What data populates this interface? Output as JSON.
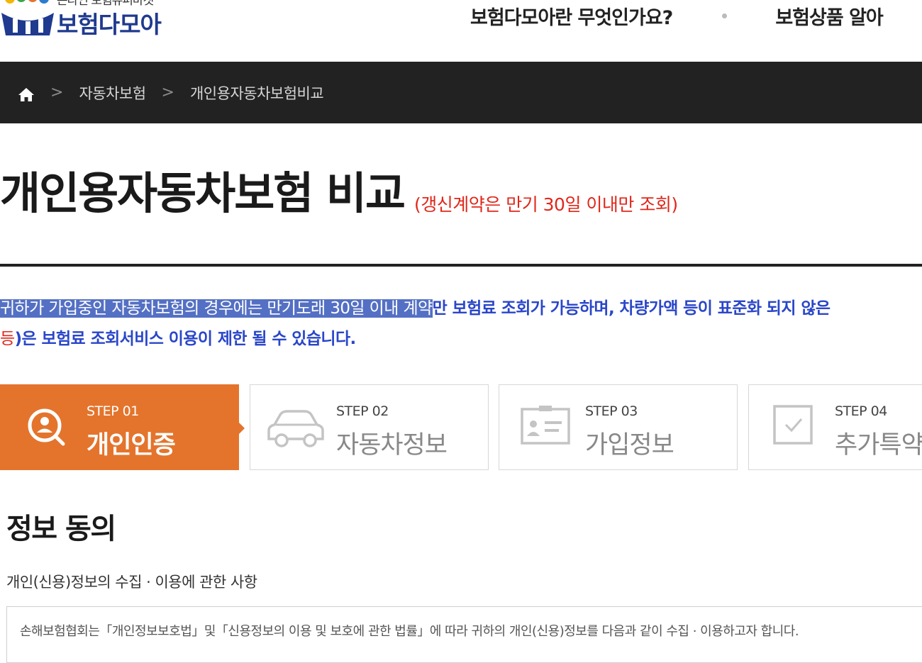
{
  "header": {
    "logo_sub": "온라인 보험슈퍼마켓",
    "logo_main": "보험다모아",
    "nav": [
      {
        "label": "보험다모아란 무엇인가요?"
      },
      {
        "label": "보험상품 알아"
      }
    ]
  },
  "breadcrumb": {
    "items": [
      {
        "label": "자동차보험"
      },
      {
        "label": "개인용자동차보험비교"
      }
    ]
  },
  "page": {
    "title": "개인용자동차보험 비교",
    "title_note": "(갱신계약은 만기 30일 이내만 조회)"
  },
  "notice": {
    "line1_highlight": "귀하가 가입중인 자동차보험의 경우에는 만기도래 30일 이내 계약",
    "line1_rest": "만 보험료 조회가 가능하며, 차량가액 등이 표준화 되지 않은",
    "line2_red": "등",
    "line2_rest": ")은 보험료 조회서비스 이용이 제한 될 수 있습니다."
  },
  "steps": [
    {
      "num": "STEP 01",
      "name": "개인인증",
      "icon": "user-search-icon",
      "active": true
    },
    {
      "num": "STEP 02",
      "name": "자동차정보",
      "icon": "car-icon",
      "active": false
    },
    {
      "num": "STEP 03",
      "name": "가입정보",
      "icon": "id-card-icon",
      "active": false
    },
    {
      "num": "STEP 04",
      "name": "추가특약",
      "icon": "checkbox-icon",
      "active": false
    }
  ],
  "consent": {
    "section_title": "정보 동의",
    "sub_title": "개인(신용)정보의 수집 · 이용에 관한 사항",
    "box_text": "손해보험협회는「개인정보보호법」및「신용정보의 이용 및 보호에 관한 법률」에 따라 귀하의 개인(신용)정보를 다음과 같이 수집 · 이용하고자 합니다."
  },
  "colors": {
    "accent": "#e4742c",
    "brand": "#1f3a8f",
    "notice": "#2a46c9",
    "warning": "#e0271b",
    "bar": "#222222"
  }
}
